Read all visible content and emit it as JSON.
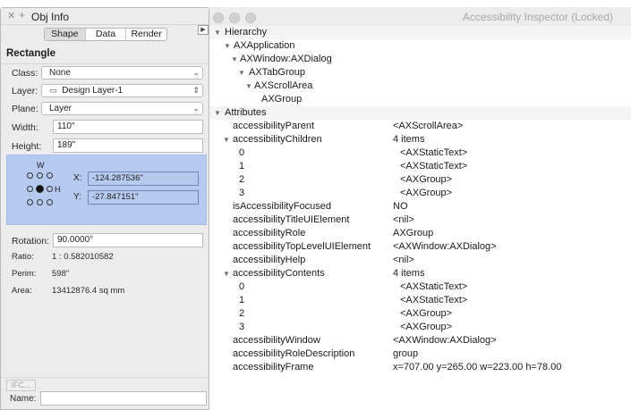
{
  "inspector": {
    "title": "Accessibility Inspector (Locked)",
    "rows": [
      {
        "indent": 0,
        "tri": "down",
        "key": "Hierarchy",
        "value": "",
        "header": true
      },
      {
        "indent": 1,
        "tri": "down",
        "key": "AXApplication",
        "value": ""
      },
      {
        "indent": 2,
        "tri": "down",
        "key": "AXWindow:AXDialog",
        "value": ""
      },
      {
        "indent": 3,
        "tri": "down",
        "key": "AXTabGroup",
        "value": ""
      },
      {
        "indent": 4,
        "tri": "down",
        "key": "AXScrollArea",
        "value": ""
      },
      {
        "indent": 5,
        "tri": "",
        "key": "AXGroup",
        "value": ""
      },
      {
        "indent": 0,
        "tri": "down",
        "key": "Attributes",
        "value": "",
        "header": true
      },
      {
        "indent": 2,
        "tri": "",
        "key": "accessibilityParent",
        "value": "<AXScrollArea>"
      },
      {
        "indent": 2,
        "tri": "down",
        "key": "accessibilityChildren",
        "value": "4 items"
      },
      {
        "indent": 3,
        "tri": "",
        "key": "0",
        "value": "<AXStaticText>",
        "sub": true
      },
      {
        "indent": 3,
        "tri": "",
        "key": "1",
        "value": "<AXStaticText>",
        "sub": true
      },
      {
        "indent": 3,
        "tri": "",
        "key": "2",
        "value": "<AXGroup>",
        "sub": true
      },
      {
        "indent": 3,
        "tri": "",
        "key": "3",
        "value": "<AXGroup>",
        "sub": true
      },
      {
        "indent": 2,
        "tri": "",
        "key": "isAccessibilityFocused",
        "value": "NO"
      },
      {
        "indent": 2,
        "tri": "",
        "key": "accessibilityTitleUIElement",
        "value": "<nil>"
      },
      {
        "indent": 2,
        "tri": "",
        "key": "accessibilityRole",
        "value": "AXGroup"
      },
      {
        "indent": 2,
        "tri": "",
        "key": "accessibilityTopLevelUIElement",
        "value": "<AXWindow:AXDialog>"
      },
      {
        "indent": 2,
        "tri": "",
        "key": "accessibilityHelp",
        "value": "<nil>"
      },
      {
        "indent": 2,
        "tri": "down",
        "key": "accessibilityContents",
        "value": "4 items"
      },
      {
        "indent": 3,
        "tri": "",
        "key": "0",
        "value": "<AXStaticText>",
        "sub": true
      },
      {
        "indent": 3,
        "tri": "",
        "key": "1",
        "value": "<AXStaticText>",
        "sub": true
      },
      {
        "indent": 3,
        "tri": "",
        "key": "2",
        "value": "<AXGroup>",
        "sub": true
      },
      {
        "indent": 3,
        "tri": "",
        "key": "3",
        "value": "<AXGroup>",
        "sub": true
      },
      {
        "indent": 2,
        "tri": "",
        "key": "accessibilityWindow",
        "value": "<AXWindow:AXDialog>"
      },
      {
        "indent": 2,
        "tri": "",
        "key": "accessibilityRoleDescription",
        "value": "group"
      },
      {
        "indent": 2,
        "tri": "",
        "key": "accessibilityFrame",
        "value": "x=707.00 y=265.00 w=223.00 h=78.00"
      }
    ]
  },
  "objinfo": {
    "title": "Obj Info",
    "close_glyph": "✕",
    "plus_glyph": "+",
    "tabs": [
      {
        "label": "Shape",
        "active": true
      },
      {
        "label": "Data",
        "active": false
      },
      {
        "label": "Render",
        "active": false
      }
    ],
    "object_type": "Rectangle",
    "class_label": "Class:",
    "class_value": "None",
    "layer_label": "Layer:",
    "layer_value": "Design Layer-1",
    "plane_label": "Plane:",
    "plane_value": "Layer",
    "width_label": "Width:",
    "width_value": "110\"",
    "height_label": "Height:",
    "height_value": "189\"",
    "ref_w": "W",
    "ref_h": "H",
    "x_label": "X:",
    "x_value": "-124.287536\"",
    "y_label": "Y:",
    "y_value": "-27.847151\"",
    "rotation_label": "Rotation:",
    "rotation_value": "90.0000°",
    "ratio_label": "Ratio:",
    "ratio_value": "1 : 0.582010582",
    "perim_label": "Perim:",
    "perim_value": "598\"",
    "area_label": "Area:",
    "area_value": "13412876.4 sq mm",
    "ifc_label": "IFC...",
    "name_label": "Name:",
    "name_value": ""
  },
  "colors": {
    "selection_blue": "#b6c9ef",
    "window_gray": "#ececec"
  }
}
